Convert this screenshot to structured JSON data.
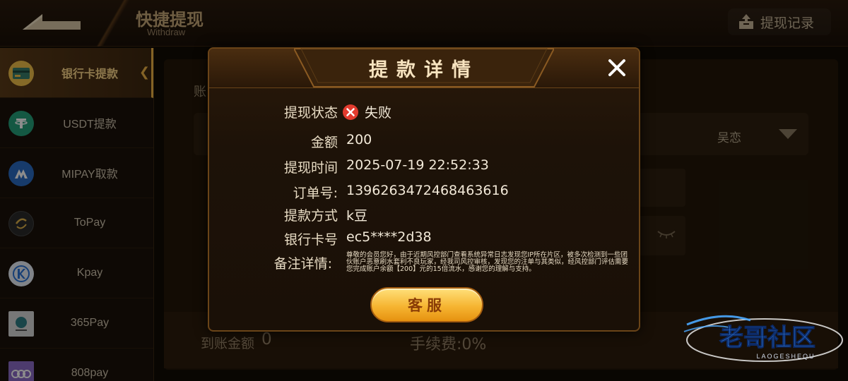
{
  "header": {
    "title_cn": "快捷提现",
    "title_en": "Withdraw",
    "records_label": "提现记录"
  },
  "sidebar": {
    "items": [
      {
        "label": "银行卡提款",
        "icon": "bank-card-icon",
        "color": "#f3c14a",
        "active": true
      },
      {
        "label": "USDT提款",
        "icon": "tether-icon",
        "color": "#26a17b",
        "active": false
      },
      {
        "label": "MIPAY取款",
        "icon": "mipay-icon",
        "color": "#2b6cc4",
        "active": false
      },
      {
        "label": "ToPay",
        "icon": "topay-icon",
        "color": "#2a2a2a",
        "active": false
      },
      {
        "label": "Kpay",
        "icon": "kpay-icon",
        "color": "#2a74d8",
        "active": false
      },
      {
        "label": "365Pay",
        "icon": "365pay-icon",
        "color": "#d9d9d9",
        "active": false
      },
      {
        "label": "808pay",
        "icon": "808pay-icon",
        "color": "#8c6cc8",
        "active": false
      }
    ]
  },
  "main": {
    "account_label": "账",
    "name_value": "吴恋",
    "arrival_label": "到账金额",
    "arrival_value": "0",
    "fee_label": "手续费:0%"
  },
  "modal": {
    "title": "提款详情",
    "rows": {
      "status": {
        "label": "提现状态",
        "value": "失败"
      },
      "amount": {
        "label": "金额",
        "value": "200"
      },
      "time": {
        "label": "提现时间",
        "value": "2025-07-19 22:52:33"
      },
      "order": {
        "label": "订单号:",
        "value": "1396263472468463616"
      },
      "method": {
        "label": "提款方式",
        "value": "k豆"
      },
      "card": {
        "label": "银行卡号",
        "value": "ec5****2d38"
      },
      "remark": {
        "label": "备注详情:",
        "value": "尊敬的会员您好，由于近期风控部门查看系统异常日志发现您IP所在片区，被多次检测到一些团伙账户恶意刷水套利不良玩家，经我司风控审核，发现您的注单与其类似，经风控部门评估需要您完成账户余额【200】元的15倍流水，感谢您的理解与支持。"
      }
    },
    "service_label": "客服"
  },
  "watermark": {
    "text": "老哥社区",
    "sub": "LAOGESHEQU"
  },
  "colors": {
    "accent": "#f0b445",
    "button": "#f6b532",
    "fail": "#e23b2e"
  }
}
